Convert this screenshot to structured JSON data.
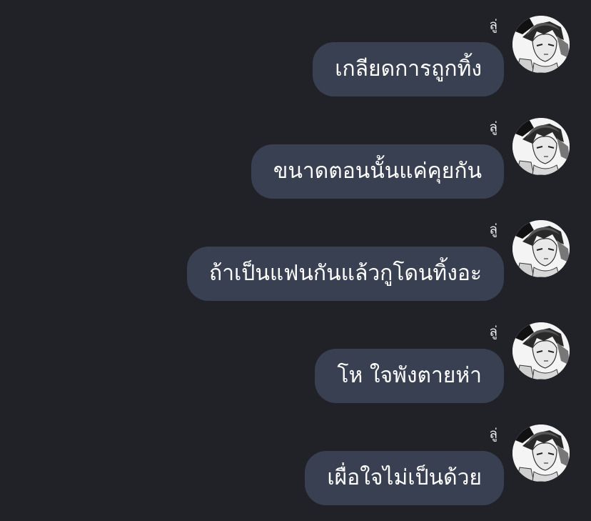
{
  "colors": {
    "background": "#212228",
    "bubble": "#394051",
    "text": "#ffffff"
  },
  "messages": [
    {
      "sender": "ลู่",
      "text": "เกลียดการถูกทิ้ง",
      "avatar_icon": "manga-character-avatar"
    },
    {
      "sender": "ลู่",
      "text": "ขนาดตอนนั้นแค่คุยกัน",
      "avatar_icon": "manga-character-avatar"
    },
    {
      "sender": "ลู่",
      "text": "ถ้าเป็นแฟนกันแล้วกูโดนทิ้งอะ",
      "avatar_icon": "manga-character-avatar"
    },
    {
      "sender": "ลู่",
      "text": "โห ใจพังตายห่า",
      "avatar_icon": "manga-character-avatar"
    },
    {
      "sender": "ลู่",
      "text": "เผื่อใจไม่เป็นด้วย",
      "avatar_icon": "manga-character-avatar"
    }
  ]
}
